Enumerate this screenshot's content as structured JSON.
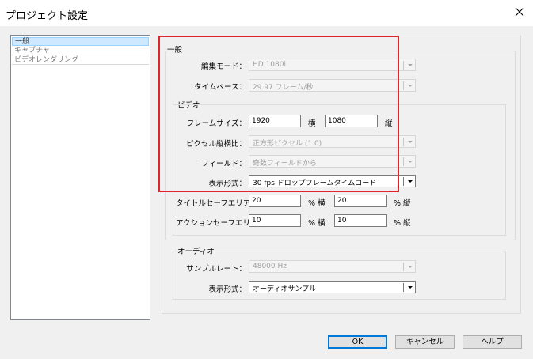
{
  "window": {
    "title": "プロジェクト設定"
  },
  "nav": {
    "items": [
      {
        "label": "一般",
        "selected": true
      },
      {
        "label": "キャプチャ",
        "selected": false
      },
      {
        "label": "ビデオレンダリング",
        "selected": false
      }
    ]
  },
  "general": {
    "heading": "一般",
    "edit_mode": {
      "label": "編集モード：",
      "value": "HD 1080i"
    },
    "timebase": {
      "label": "タイムベース：",
      "value": "29.97 フレーム/秒"
    }
  },
  "video": {
    "heading": "ビデオ",
    "frame_size": {
      "label": "フレームサイズ：",
      "width": "1920",
      "height": "1080",
      "width_unit": "横",
      "height_unit": "縦"
    },
    "pixel_aspect": {
      "label": "ピクセル縦横比：",
      "value": "正方形ピクセル (1.0)"
    },
    "field": {
      "label": "フィールド：",
      "value": "奇数フィールドから"
    },
    "display_format": {
      "label": "表示形式：",
      "value": "30 fps ドロップフレームタイムコード"
    },
    "title_safe": {
      "label": "タイトルセーフエリア",
      "h": "20",
      "v": "20",
      "unit_h": "% 横",
      "unit_v": "% 縦"
    },
    "action_safe": {
      "label": "アクションセーフエリア",
      "h": "10",
      "v": "10",
      "unit_h": "% 横",
      "unit_v": "% 縦"
    }
  },
  "audio": {
    "heading": "オーディオ",
    "sample_rate": {
      "label": "サンプルレート：",
      "value": "48000 Hz"
    },
    "display_format": {
      "label": "表示形式：",
      "value": "オーディオサンプル"
    }
  },
  "buttons": {
    "ok": "OK",
    "cancel": "キャンセル",
    "help": "ヘルプ"
  },
  "colors": {
    "highlight_box": "#e0242b",
    "selection": "#cde8ff",
    "default_button_border": "#0078d7"
  },
  "icons": {
    "close": "close-icon",
    "dropdown": "chevron-down-icon"
  }
}
